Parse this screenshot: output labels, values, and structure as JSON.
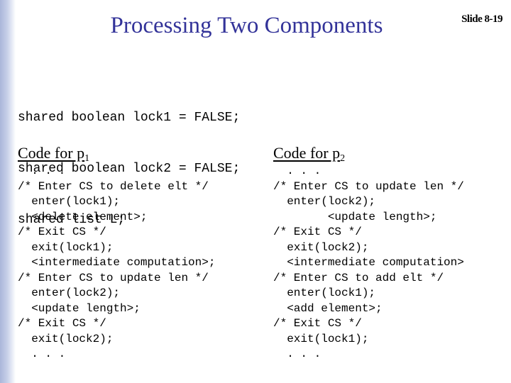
{
  "slide": {
    "title": "Processing Two Components",
    "slide_number": "Slide 8-19",
    "accent_color": "#333399"
  },
  "shared_declarations": [
    "shared boolean lock1 = FALSE;",
    "shared boolean lock2 = FALSE;",
    "shared list L;"
  ],
  "columns": [
    {
      "heading": "Code for p",
      "subscript": "1",
      "lines": [
        "  . . .",
        "/* Enter CS to delete elt */",
        "  enter(lock1);",
        "  <delete element>;",
        "/* Exit CS */",
        "  exit(lock1);",
        "  <intermediate computation>;",
        "/* Enter CS to update len */",
        "  enter(lock2);",
        "  <update length>;",
        "/* Exit CS */",
        "  exit(lock2);",
        "  . . ."
      ]
    },
    {
      "heading": "Code for p",
      "subscript": "2",
      "lines": [
        "  . . .",
        "/* Enter CS to update len */",
        "  enter(lock2);",
        "        <update length>;",
        "/* Exit CS */",
        "  exit(lock2);",
        "  <intermediate computation>",
        "/* Enter CS to add elt */",
        "  enter(lock1);",
        "  <add element>;",
        "/* Exit CS */",
        "  exit(lock1);",
        "  . . ."
      ]
    }
  ]
}
